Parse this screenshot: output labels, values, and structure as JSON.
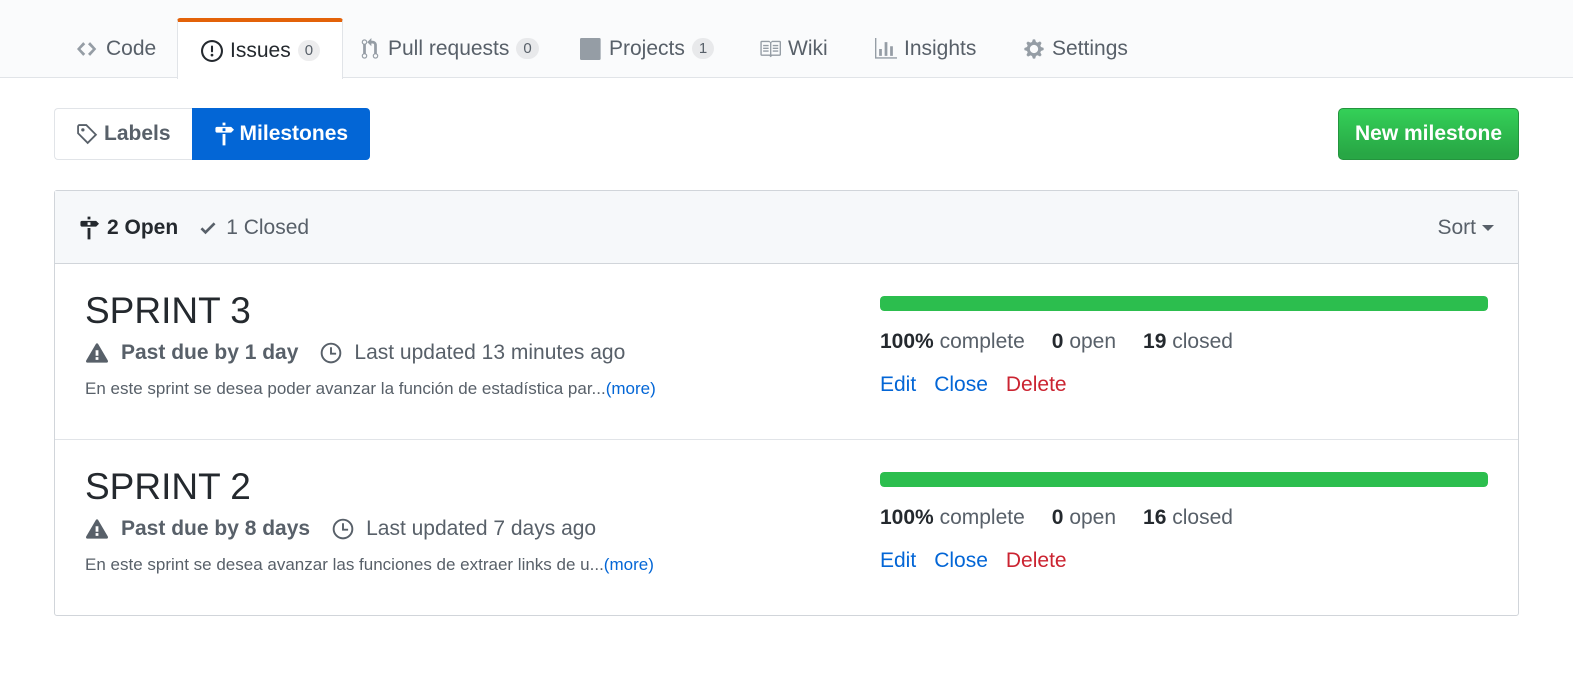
{
  "reponav": {
    "tabs": [
      {
        "label": "Code",
        "icon": "code-icon"
      },
      {
        "label": "Issues",
        "icon": "issue-opened-icon",
        "count": "0",
        "selected": true
      },
      {
        "label": "Pull requests",
        "icon": "git-pull-request-icon",
        "count": "0"
      },
      {
        "label": "Projects",
        "icon": "project-icon",
        "count": "1"
      },
      {
        "label": "Wiki",
        "icon": "book-icon"
      },
      {
        "label": "Insights",
        "icon": "graph-icon"
      },
      {
        "label": "Settings",
        "icon": "gear-icon"
      }
    ]
  },
  "subnav": {
    "labels": "Labels",
    "milestones": "Milestones"
  },
  "new_milestone_label": "New milestone",
  "colors": {
    "accent_blue": "#0366d6",
    "green": "#28a745",
    "progress_green": "#2cbe4e",
    "danger_red": "#cb2431",
    "tab_highlight": "#e36209"
  },
  "header": {
    "open_label": "2 Open",
    "closed_label": "1 Closed",
    "sort_label": "Sort"
  },
  "milestones": [
    {
      "title": "SPRINT 3",
      "due": "Past due by 1 day",
      "updated": "Last updated 13 minutes ago",
      "description": "En este sprint se desea poder avanzar la función de estadística par...",
      "more": "(more)",
      "progress_percent": 100,
      "percent": "100%",
      "complete": "complete",
      "open_count": "0",
      "open_label": "open",
      "closed_count": "19",
      "closed_label": "closed",
      "edit": "Edit",
      "close": "Close",
      "delete": "Delete"
    },
    {
      "title": "SPRINT 2",
      "due": "Past due by 8 days",
      "updated": "Last updated 7 days ago",
      "description": "En este sprint se desea avanzar las funciones de extraer links de u...",
      "more": "(more)",
      "progress_percent": 100,
      "percent": "100%",
      "complete": "complete",
      "open_count": "0",
      "open_label": "open",
      "closed_count": "16",
      "closed_label": "closed",
      "edit": "Edit",
      "close": "Close",
      "delete": "Delete"
    }
  ]
}
